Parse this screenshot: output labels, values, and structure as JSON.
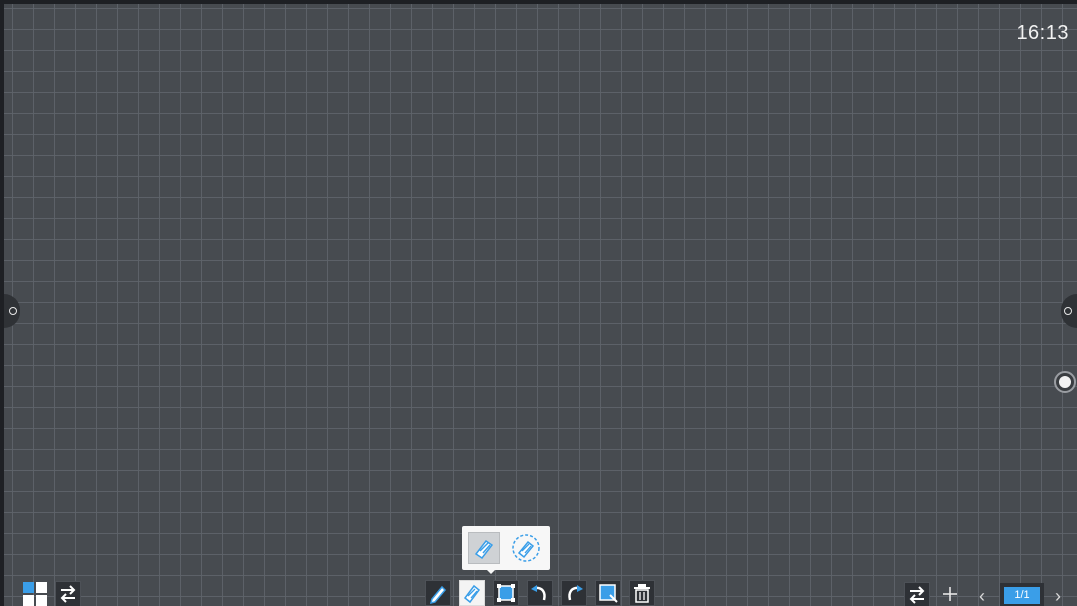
{
  "status_bar": {
    "time": "16:13"
  },
  "toolbar_center": {
    "tools": [
      {
        "name": "pen",
        "icon": "pen-icon"
      },
      {
        "name": "eraser",
        "icon": "eraser-icon",
        "active": true
      },
      {
        "name": "select",
        "icon": "select-icon"
      },
      {
        "name": "undo",
        "icon": "undo-icon"
      },
      {
        "name": "redo",
        "icon": "redo-icon"
      },
      {
        "name": "screenshot",
        "icon": "screenshot-icon"
      },
      {
        "name": "clear",
        "icon": "trash-icon"
      }
    ]
  },
  "eraser_popup": {
    "options": [
      {
        "name": "point-eraser",
        "icon": "eraser-icon",
        "selected": true
      },
      {
        "name": "area-eraser",
        "icon": "area-eraser-icon",
        "selected": false
      }
    ]
  },
  "toolbar_left": {
    "items": [
      {
        "name": "apps",
        "icon": "grid-icon"
      },
      {
        "name": "switch",
        "icon": "swap-icon"
      }
    ]
  },
  "toolbar_right": {
    "page_indicator": "1/1",
    "items": [
      {
        "name": "switch",
        "icon": "swap-icon"
      },
      {
        "name": "add-page",
        "icon": "plus-icon"
      },
      {
        "name": "prev-page",
        "icon": "chevron-left-icon"
      },
      {
        "name": "next-page",
        "icon": "chevron-right-icon"
      }
    ]
  },
  "colors": {
    "board": "#474b50",
    "grid_line": "#5f646a",
    "accent": "#3a9ee8",
    "toolbar_bg": "#2e3136",
    "text": "#f2f2f2"
  }
}
